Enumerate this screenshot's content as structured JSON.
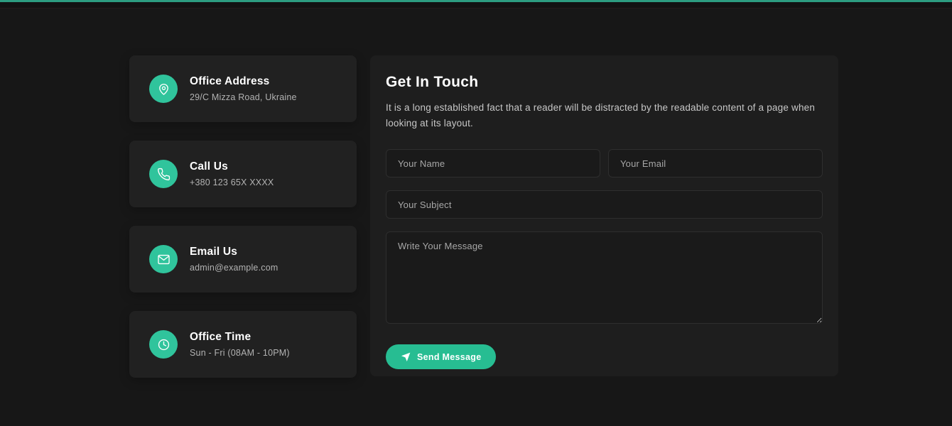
{
  "page": {
    "background": "#171717",
    "top_accent_color": "#2d9c80"
  },
  "colors": {
    "accent": "#30c49c",
    "button": "#27bd92",
    "card_background": "#212121",
    "panel_background": "#1e1e1e"
  },
  "contact_cards": [
    {
      "icon": "map-pin-icon",
      "title": "Office Address",
      "subtitle": "29/C Mizza Road, Ukraine"
    },
    {
      "icon": "phone-icon",
      "title": "Call Us",
      "subtitle": "+380 123 65X XXXX"
    },
    {
      "icon": "envelope-icon",
      "title": "Email Us",
      "subtitle": "admin@example.com"
    },
    {
      "icon": "clock-icon",
      "title": "Office Time",
      "subtitle": "Sun - Fri (08AM - 10PM)"
    }
  ],
  "form": {
    "title": "Get In Touch",
    "description": "It is a long established fact that a reader will be distracted by the readable content of a page when looking at its layout.",
    "fields": {
      "name_placeholder": "Your Name",
      "email_placeholder": "Your Email",
      "subject_placeholder": "Your Subject",
      "message_placeholder": "Write Your Message"
    },
    "submit_label": "Send Message"
  }
}
